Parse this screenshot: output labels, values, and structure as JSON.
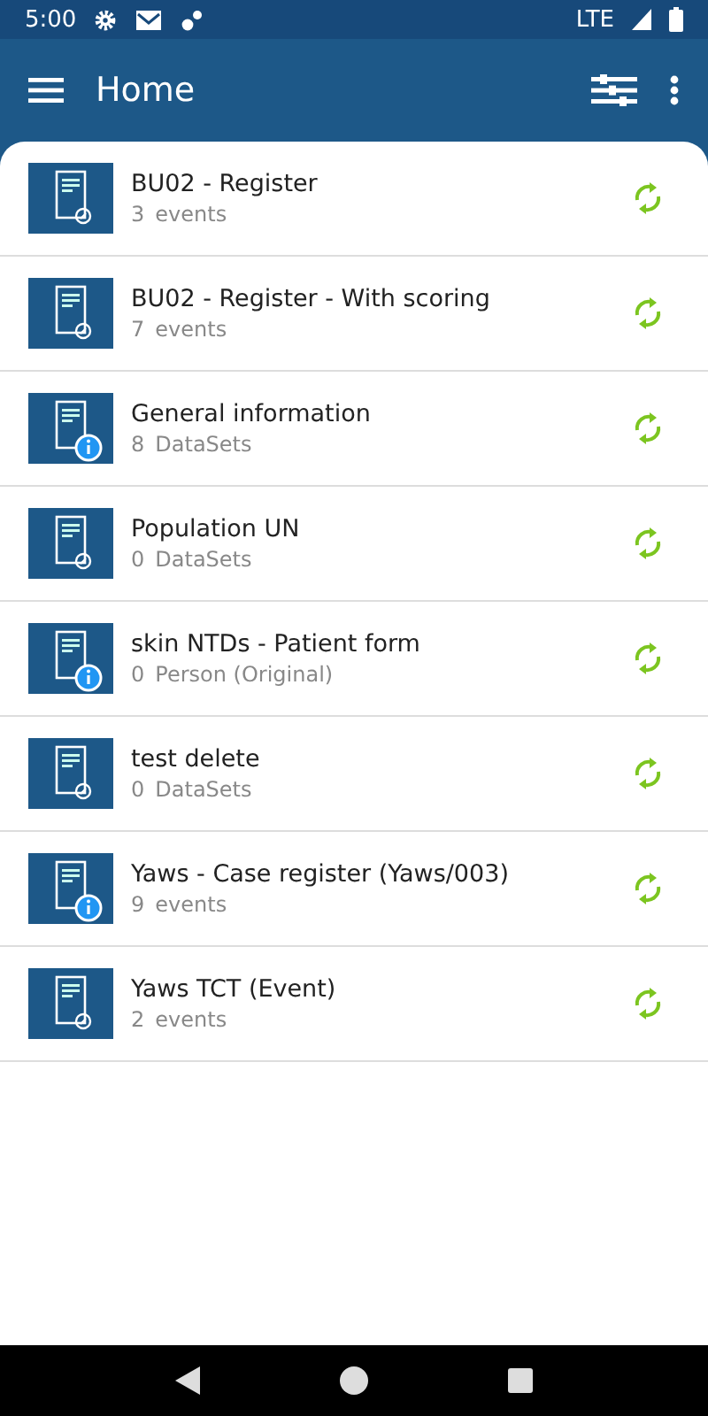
{
  "status_bar": {
    "time": "5:00",
    "network": "LTE"
  },
  "app_bar": {
    "title": "Home"
  },
  "programs": [
    {
      "title": "BU02 - Register",
      "count": "3",
      "unit": "events",
      "info": false
    },
    {
      "title": "BU02 - Register - With scoring",
      "count": "7",
      "unit": "events",
      "info": false
    },
    {
      "title": "General information",
      "count": "8",
      "unit": "DataSets",
      "info": true
    },
    {
      "title": "Population UN",
      "count": "0",
      "unit": "DataSets",
      "info": false
    },
    {
      "title": "skin NTDs - Patient form",
      "count": "0",
      "unit": "Person (Original)",
      "info": true
    },
    {
      "title": "test delete",
      "count": "0",
      "unit": "DataSets",
      "info": false
    },
    {
      "title": "Yaws - Case register (Yaws/003)",
      "count": "9",
      "unit": "events",
      "info": true
    },
    {
      "title": "Yaws TCT (Event)",
      "count": "2",
      "unit": "events",
      "info": false
    }
  ]
}
